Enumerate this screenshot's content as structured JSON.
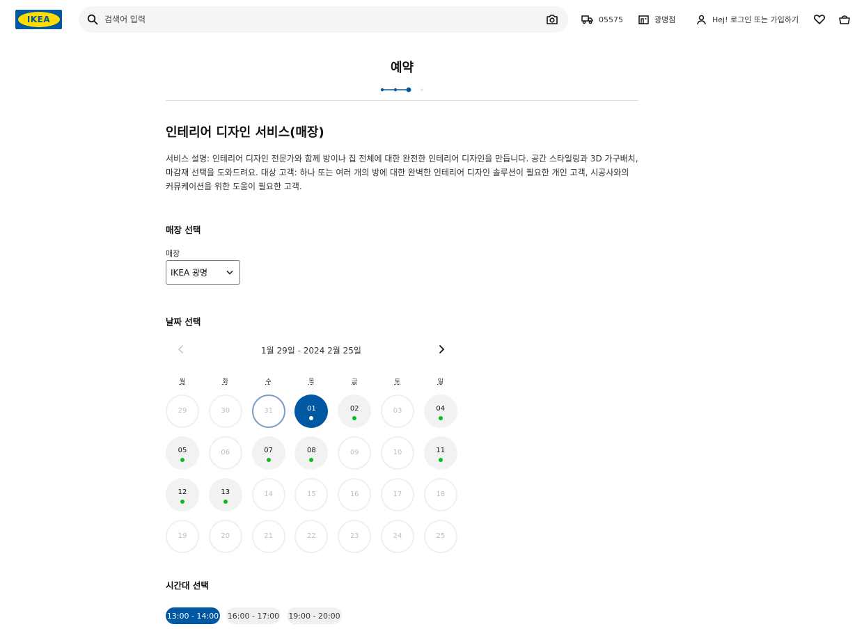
{
  "header": {
    "logo_text": "IKEA",
    "search_placeholder": "검색어 입력",
    "postal_code": "05575",
    "store": "광명점",
    "login": "Hej! 로그인 또는 가입하기"
  },
  "page": {
    "title": "예약",
    "progress": {
      "steps": 4,
      "current": 3
    }
  },
  "service": {
    "title": "인테리어 디자인 서비스(매장)",
    "description": "서비스 설명: 인테리어 디자인 전문가와 함께 방이나 집 전체에 대한 완전한 인테리어 디자인을 만듭니다. 공간 스타일링과 3D 가구배치, 마감재 선택을 도와드려요. 대상 고객: 하나 또는 여러 개의 방에 대한 완벽한 인테리어 디자인 솔루션이 필요한 개인 고객, 시공사와의 커뮤케이션을 위한 도움이 필요한 고객."
  },
  "store_section": {
    "heading": "매장 선택",
    "field_label": "매장",
    "selected_store": "IKEA 광명"
  },
  "date_section": {
    "heading": "날짜 선택",
    "range": "1월 29일 - 2024 2월 25일",
    "weekdays": [
      "월",
      "화",
      "수",
      "목",
      "금",
      "토",
      "일"
    ],
    "days": [
      {
        "label": "29",
        "state": "disabled"
      },
      {
        "label": "30",
        "state": "disabled"
      },
      {
        "label": "31",
        "state": "today"
      },
      {
        "label": "01",
        "state": "selected"
      },
      {
        "label": "02",
        "state": "available"
      },
      {
        "label": "03",
        "state": "disabled"
      },
      {
        "label": "04",
        "state": "available"
      },
      {
        "label": "05",
        "state": "available"
      },
      {
        "label": "06",
        "state": "disabled"
      },
      {
        "label": "07",
        "state": "available"
      },
      {
        "label": "08",
        "state": "available"
      },
      {
        "label": "09",
        "state": "disabled"
      },
      {
        "label": "10",
        "state": "disabled"
      },
      {
        "label": "11",
        "state": "available"
      },
      {
        "label": "12",
        "state": "available"
      },
      {
        "label": "13",
        "state": "available"
      },
      {
        "label": "14",
        "state": "disabled"
      },
      {
        "label": "15",
        "state": "disabled"
      },
      {
        "label": "16",
        "state": "disabled"
      },
      {
        "label": "17",
        "state": "disabled"
      },
      {
        "label": "18",
        "state": "disabled"
      },
      {
        "label": "19",
        "state": "disabled"
      },
      {
        "label": "20",
        "state": "disabled"
      },
      {
        "label": "21",
        "state": "disabled"
      },
      {
        "label": "22",
        "state": "disabled"
      },
      {
        "label": "23",
        "state": "disabled"
      },
      {
        "label": "24",
        "state": "disabled"
      },
      {
        "label": "25",
        "state": "disabled"
      }
    ]
  },
  "time_section": {
    "heading": "시간대 선택",
    "slots": [
      {
        "label": "13:00 - 14:00",
        "selected": true
      },
      {
        "label": "16:00 - 17:00",
        "selected": false
      },
      {
        "label": "19:00 - 20:00",
        "selected": false
      }
    ]
  },
  "colors": {
    "brand_blue": "#0058a3",
    "brand_yellow": "#ffdb00",
    "available_dot": "#0dbb21"
  },
  "icons": [
    "search-icon",
    "camera-icon",
    "truck-icon",
    "store-icon",
    "user-icon",
    "heart-icon",
    "basket-icon",
    "chevron-down-icon",
    "chevron-left-icon",
    "chevron-right-icon"
  ]
}
